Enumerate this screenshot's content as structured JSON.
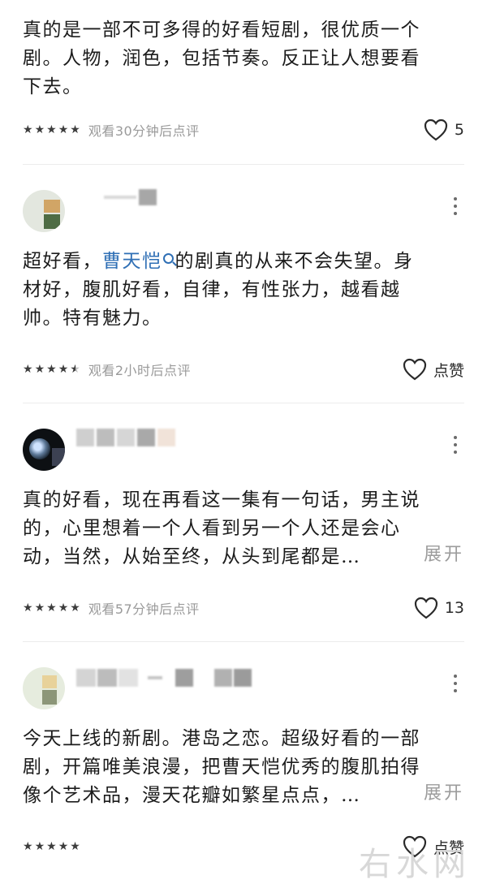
{
  "comments": [
    {
      "lines": [
        "真的是一部不可多得的好看短剧，很优质一个",
        "剧。人物，润色，包括节奏。反正让人想要看",
        "下去。"
      ],
      "rating": 5,
      "watch_note": "观看30分钟后点评",
      "like": "5"
    },
    {
      "line1_pre": "超好看，",
      "mention": "曹天恺",
      "line1_post": "的剧真的从来不会失望。身",
      "lines_rest": [
        "材好，腹肌好看，自律，有性张力，越看越",
        "帅。特有魅力。"
      ],
      "rating": 4.5,
      "watch_note": "观看2小时后点评",
      "like": "点赞"
    },
    {
      "lines": [
        "真的好看，现在再看这一集有一句话，男主说",
        "的，心里想着一个人看到另一个人还是会心",
        "动，当然，从始至终，从头到尾都是…"
      ],
      "expand": "展开",
      "rating": 5,
      "watch_note": "观看57分钟后点评",
      "like": "13"
    },
    {
      "lines": [
        "今天上线的新剧。港岛之恋。超级好看的一部",
        "剧，开篇唯美浪漫，把曹天恺优秀的腹肌拍得",
        "像个艺术品，漫天花瓣如繁星点点，…"
      ],
      "expand": "展开",
      "like": "点赞"
    }
  ],
  "watermark": "右水网",
  "colors": {
    "mention": "#2f6fb5",
    "muted": "#9a9a9a"
  },
  "icons": [
    "heart-icon",
    "star-icon",
    "more-vertical-icon",
    "search-icon"
  ]
}
